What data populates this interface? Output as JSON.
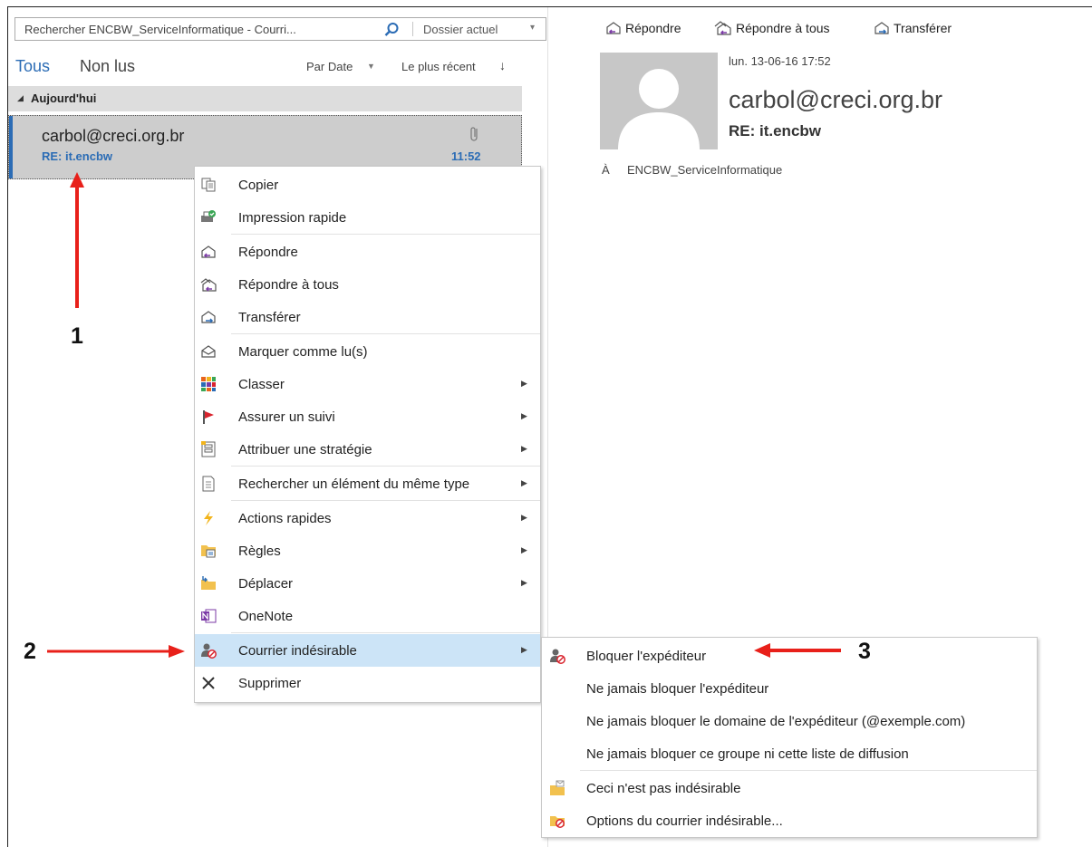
{
  "search": {
    "text": "Rechercher ENCBW_ServiceInformatique - Courri...",
    "scope": "Dossier actuel"
  },
  "filters": {
    "all": "Tous",
    "unread": "Non lus",
    "sort_by": "Par Date",
    "sort_order": "Le plus récent"
  },
  "group": {
    "label": "Aujourd'hui"
  },
  "email": {
    "sender": "carbol@creci.org.br",
    "subject": "RE: it.encbw",
    "time": "11:52"
  },
  "reading": {
    "actions": {
      "reply": "Répondre",
      "reply_all": "Répondre à tous",
      "forward": "Transférer"
    },
    "date": "lun. 13-06-16 17:52",
    "sender": "carbol@creci.org.br",
    "subject": "RE: it.encbw",
    "to_label": "À",
    "to": "ENCBW_ServiceInformatique"
  },
  "context_menu": {
    "items": [
      {
        "label": "Copier",
        "icon": "copy-icon"
      },
      {
        "label": "Impression rapide",
        "icon": "quick-print-icon"
      },
      {
        "label": "Répondre",
        "icon": "reply-icon"
      },
      {
        "label": "Répondre à tous",
        "icon": "reply-all-icon"
      },
      {
        "label": "Transférer",
        "icon": "forward-icon"
      },
      {
        "label": "Marquer comme lu(s)",
        "icon": "mark-read-icon"
      },
      {
        "label": "Classer",
        "icon": "categorize-icon"
      },
      {
        "label": "Assurer un suivi",
        "icon": "flag-icon"
      },
      {
        "label": "Attribuer une stratégie",
        "icon": "policy-icon"
      },
      {
        "label": "Rechercher un élément du même type",
        "icon": "find-related-icon"
      },
      {
        "label": "Actions rapides",
        "icon": "lightning-icon"
      },
      {
        "label": "Règles",
        "icon": "rules-icon"
      },
      {
        "label": "Déplacer",
        "icon": "move-folder-icon"
      },
      {
        "label": "OneNote",
        "icon": "onenote-icon"
      },
      {
        "label": "Courrier indésirable",
        "icon": "junk-icon"
      },
      {
        "label": "Supprimer",
        "icon": "delete-icon"
      }
    ]
  },
  "submenu": {
    "items": [
      {
        "label": "Bloquer l'expéditeur",
        "icon": "block-sender-icon"
      },
      {
        "label": "Ne jamais bloquer l'expéditeur",
        "icon": ""
      },
      {
        "label": "Ne jamais bloquer le domaine de l'expéditeur (@exemple.com)",
        "icon": ""
      },
      {
        "label": "Ne jamais bloquer ce groupe ni cette liste de diffusion",
        "icon": ""
      },
      {
        "label": "Ceci n'est pas indésirable",
        "icon": "not-junk-icon"
      },
      {
        "label": "Options du courrier indésirable...",
        "icon": "junk-options-icon"
      }
    ]
  },
  "annotations": {
    "n1": "1",
    "n2": "2",
    "n3": "3"
  },
  "colors": {
    "accent": "#2b6cb5",
    "selection": "#cdcdcd",
    "menu_highlight": "#cce4f7",
    "arrow": "#e8201a"
  }
}
